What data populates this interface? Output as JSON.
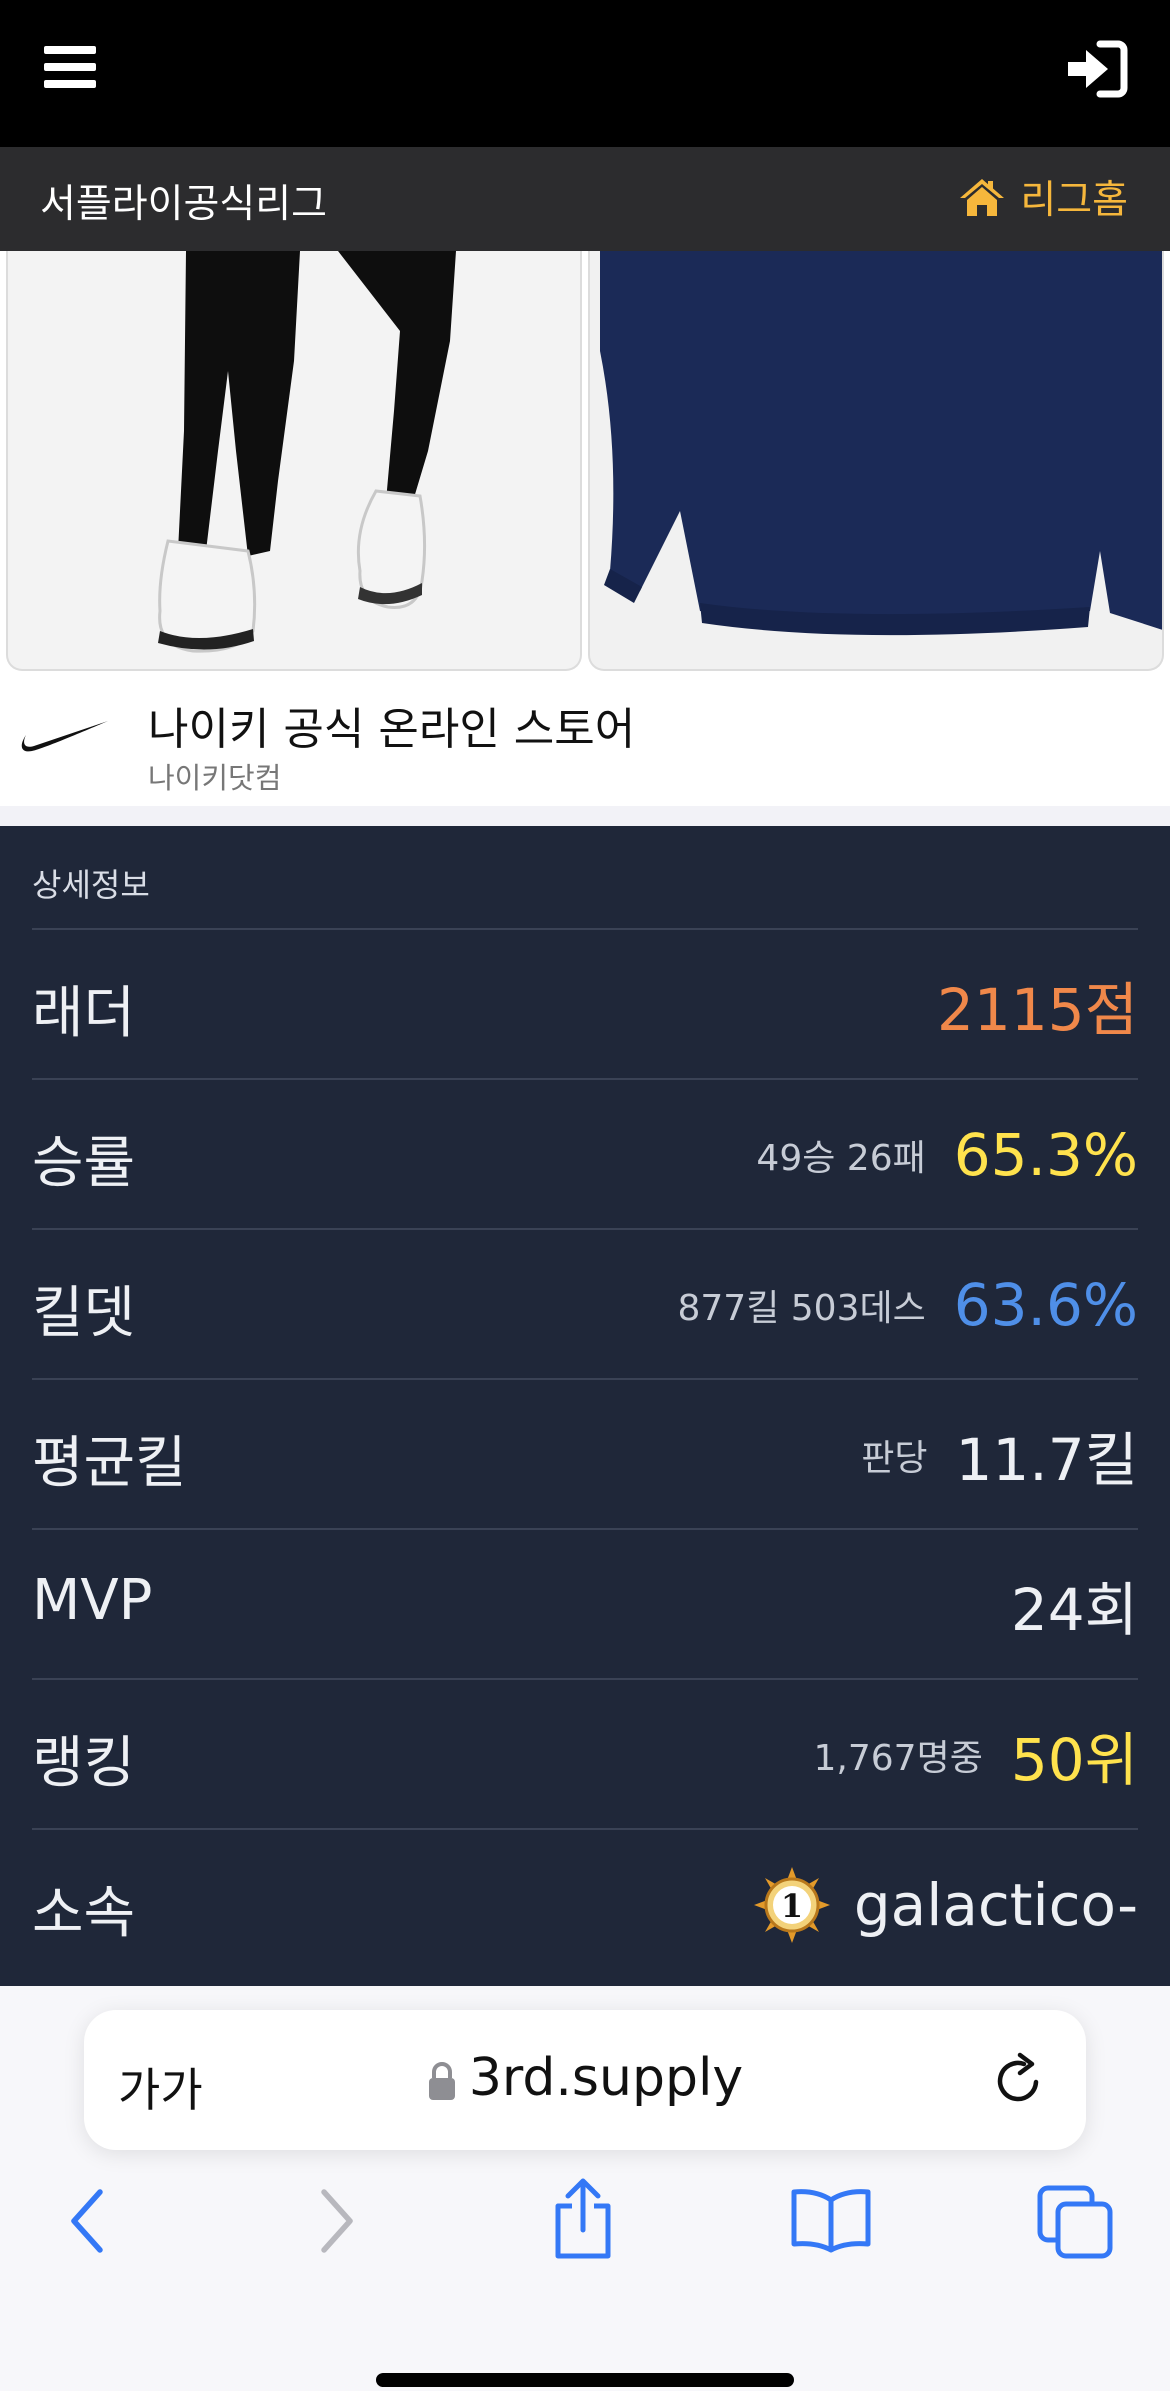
{
  "header": {
    "menu_icon": "hamburger-icon",
    "login_icon": "sign-in-icon"
  },
  "league": {
    "title": "서플라이공식리그",
    "home_label": "리그홈",
    "home_icon": "home-icon",
    "home_color": "#f6b73c"
  },
  "ad": {
    "title": "나이키 공식 온라인 스토어",
    "subtitle": "나이키닷컴",
    "brand_icon": "nike-swoosh-icon"
  },
  "stats": {
    "header": "상세정보",
    "rows": [
      {
        "label": "래더",
        "sub": "",
        "value": "2115점",
        "value_color": "#f0884a"
      },
      {
        "label": "승률",
        "sub": "49승 26패",
        "value": "65.3%",
        "value_color": "#ffe24d"
      },
      {
        "label": "킬뎃",
        "sub": "877킬 503데스",
        "value": "63.6%",
        "value_color": "#4f8fe8"
      },
      {
        "label": "평균킬",
        "sub": "판당",
        "value": "11.7킬",
        "value_color": "#eef0f4"
      },
      {
        "label": "MVP",
        "sub": "",
        "value": "24회",
        "value_color": "#eef0f4"
      },
      {
        "label": "랭킹",
        "sub": "1,767명중",
        "value": "50위",
        "value_color": "#ffe24d"
      },
      {
        "label": "소속",
        "sub": "",
        "value": "galactico-",
        "value_color": "#eef0f4",
        "badge_icon": "clan-badge-icon",
        "badge_text": "1"
      }
    ]
  },
  "browser": {
    "text_size_label": "가가",
    "url": "3rd.supply",
    "accent": "#3478f6",
    "toolbar": [
      "back-icon",
      "forward-icon",
      "share-icon",
      "bookmarks-icon",
      "tabs-icon"
    ]
  }
}
